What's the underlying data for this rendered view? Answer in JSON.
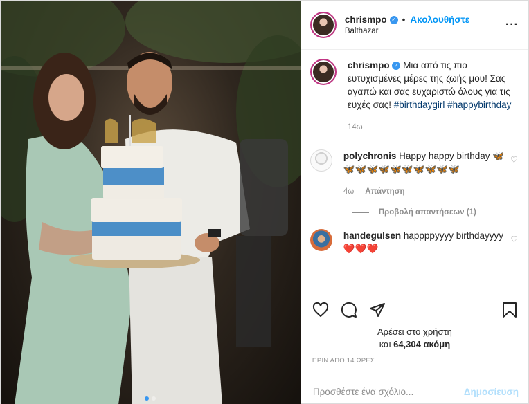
{
  "post": {
    "username": "chrismpo",
    "verified": true,
    "follow_label": "Ακολουθήστε",
    "separator": "•",
    "location": "Balthazar",
    "more_icon": "more-horizontal-icon"
  },
  "caption": {
    "username": "chrismpo",
    "text": "Μια από τις πιο ευτυχισμένες μέρες της ζωής μου! Σας αγαπώ και σας ευχαριστώ όλους για τις ευχές σας!",
    "hashtag_1": "#birthdaygirl",
    "hashtag_2": "#happybirthday",
    "age": "14ω"
  },
  "comments": [
    {
      "username": "polychronis",
      "text": "Happy happy birthday 🦋🦋🦋🦋🦋🦋🦋🦋🦋🦋🦋",
      "age": "4ω",
      "reply_label": "Απάντηση"
    },
    {
      "username": "handegulsen",
      "text": "happppyyyy birthdayyyy ❤️❤️❤️"
    }
  ],
  "view_replies_label": "Προβολή απαντήσεων (1)",
  "likes": {
    "line1": "Αρέσει στο χρήστη",
    "line2_prefix": "και",
    "count": "64,304",
    "line2_suffix": "ακόμη"
  },
  "timestamp": "ΠΡΙΝ ΑΠΟ 14 ΩΡΕΣ",
  "comment_box": {
    "placeholder": "Προσθέστε ένα σχόλιο...",
    "post_label": "Δημοσίευση"
  },
  "carousel": {
    "slides": 2,
    "active": 1
  },
  "colors": {
    "accent": "#0095f6",
    "verified": "#3897f0",
    "heart": "#ed4956"
  }
}
